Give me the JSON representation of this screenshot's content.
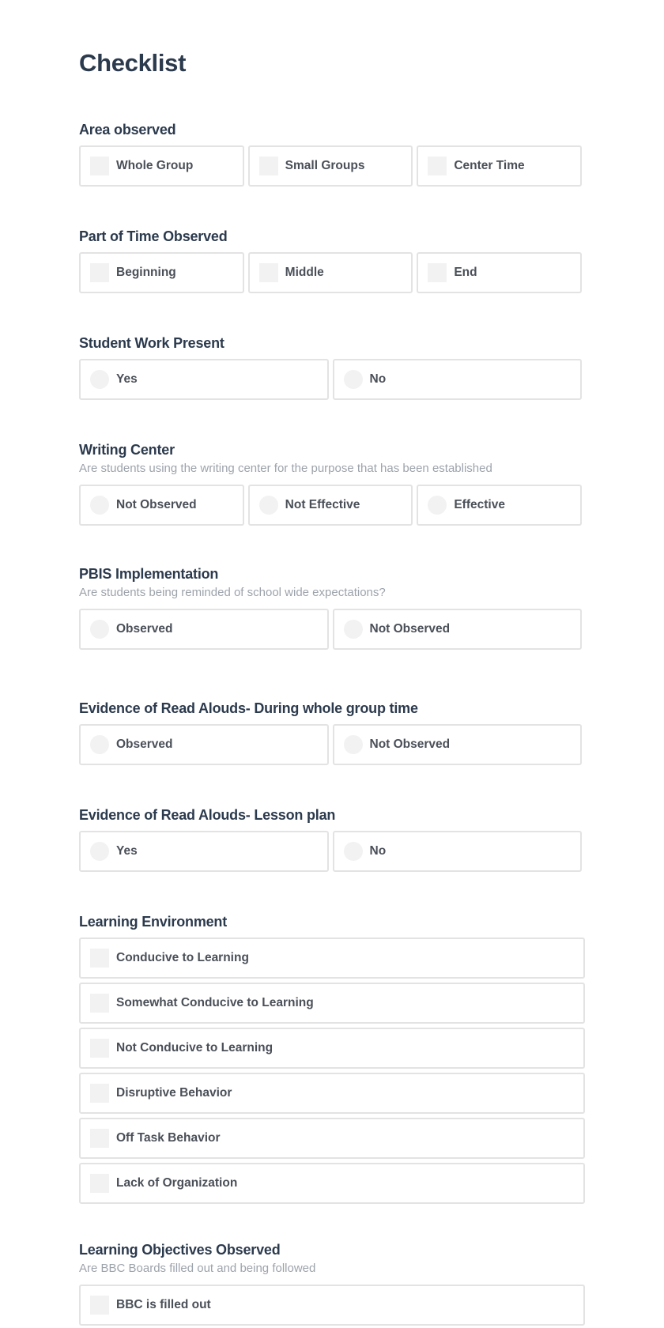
{
  "page": {
    "title": "Checklist"
  },
  "sections": [
    {
      "title": "Area observed",
      "description": "",
      "control": "checkbox",
      "options": [
        "Whole Group",
        "Small Groups",
        "Center Time"
      ]
    },
    {
      "title": "Part of Time Observed",
      "description": "",
      "control": "checkbox",
      "options": [
        "Beginning",
        "Middle",
        "End"
      ]
    },
    {
      "title": "Student Work Present",
      "description": "",
      "control": "radio",
      "options": [
        "Yes",
        "No"
      ]
    },
    {
      "title": "Writing Center",
      "description": "Are students using the writing center for the purpose that has been established",
      "control": "radio",
      "options": [
        "Not Observed",
        "Not Effective",
        "Effective"
      ]
    },
    {
      "title": "PBIS Implementation",
      "description": "Are students being reminded of school wide expectations?",
      "control": "radio",
      "options": [
        "Observed",
        "Not Observed"
      ]
    },
    {
      "title": "Evidence of Read Alouds- During whole group time",
      "description": "",
      "control": "radio",
      "options": [
        "Observed",
        "Not Observed"
      ]
    },
    {
      "title": "Evidence of Read Alouds- Lesson plan",
      "description": "",
      "control": "radio",
      "options": [
        "Yes",
        "No"
      ]
    },
    {
      "title": "Learning Environment",
      "description": "",
      "control": "checkbox",
      "layout": "list",
      "options": [
        "Conducive to Learning",
        "Somewhat Conducive to Learning",
        "Not Conducive to Learning",
        "Disruptive Behavior",
        "Off Task Behavior",
        "Lack of Organization"
      ]
    },
    {
      "title": "Learning Objectives Observed",
      "description": "Are BBC Boards filled out and being followed",
      "control": "checkbox",
      "layout": "list",
      "options": [
        "BBC is filled out"
      ]
    }
  ]
}
